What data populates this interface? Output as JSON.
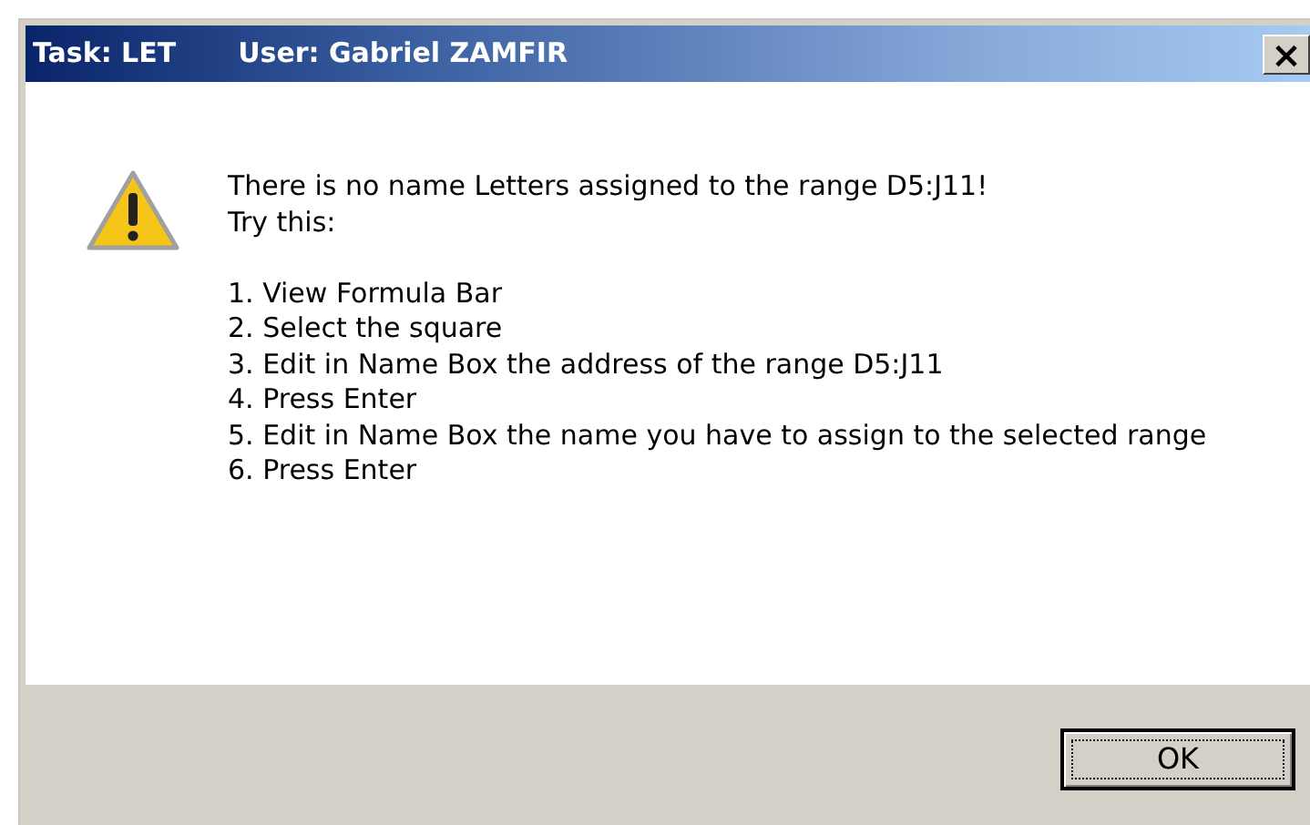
{
  "window": {
    "title_parts": [
      "Task: LET",
      "User: Gabriel ZAMFIR"
    ],
    "close": "×"
  },
  "message": {
    "lines": [
      "There is no name Letters assigned to the range D5:J11!",
      "Try this:"
    ],
    "steps": [
      "1. View Formula Bar",
      "2. Select the square",
      "3. Edit in Name Box the address of the range D5:J11",
      "4. Press Enter",
      "5. Edit in Name Box the name you have to assign to the selected range",
      "6. Press Enter"
    ]
  },
  "buttons": [
    {
      "label": "OK"
    }
  ]
}
